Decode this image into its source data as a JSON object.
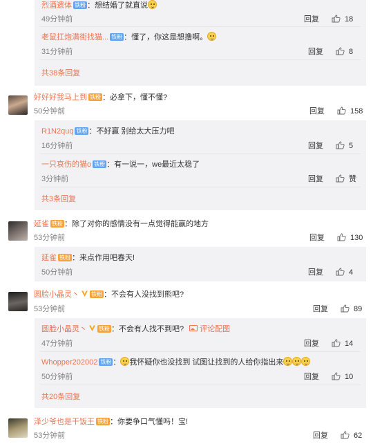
{
  "reply_label": "回复",
  "praise_label": "赞",
  "badges": {
    "iron": "铁粉"
  },
  "top_thread": {
    "replies": [
      {
        "name": "烈酒遗体",
        "text": "：想结婚了就直说",
        "time": "49分钟前",
        "likes": "18"
      },
      {
        "name": "老鼠扛炮满街找猫...",
        "text": "：懂了，你这是想撸啊。",
        "time": "31分钟前",
        "likes": "8"
      }
    ],
    "more": "共38条回复"
  },
  "comments": [
    {
      "name": "好好好我马上到",
      "text": "：必拿下，懂不懂?",
      "time": "50分钟前",
      "likes": "158",
      "replies": [
        {
          "name": "R1N2quq",
          "text": "：不好赢 别给太大压力吧",
          "time": "16分钟前",
          "likes": "5"
        },
        {
          "name": "一只哀伤的猫o",
          "text": "：有一说一，we最近太稳了",
          "time": "3分钟前",
          "likes": "赞"
        }
      ],
      "more": "共3条回复"
    },
    {
      "name": "延雀",
      "text": "：除了对你的感情没有一点觉得能赢的地方",
      "time": "53分钟前",
      "likes": "130",
      "replies": [
        {
          "name": "延雀",
          "text": "：来点作用吧春天!",
          "time": "50分钟前",
          "likes": "4"
        }
      ]
    },
    {
      "name": "圆脸小晶灵丶",
      "text": "：不会有人没找到熊吧?",
      "time": "53分钟前",
      "likes": "89",
      "replies": [
        {
          "name": "圆脸小晶灵丶",
          "text": "：不会有人找不到吧?",
          "extra": "评论配图",
          "time": "47分钟前",
          "likes": "14"
        },
        {
          "name": "Whopper202002",
          "text": "我怀疑你也没找到 试图让找到的人给你指出来",
          "time": "50分钟前",
          "likes": "10"
        }
      ],
      "more": "共20条回复"
    },
    {
      "name": "泽少爷也是干饭王",
      "text": "：你要争口气懂吗！宝!",
      "time": "53分钟前",
      "likes": "62"
    }
  ]
}
